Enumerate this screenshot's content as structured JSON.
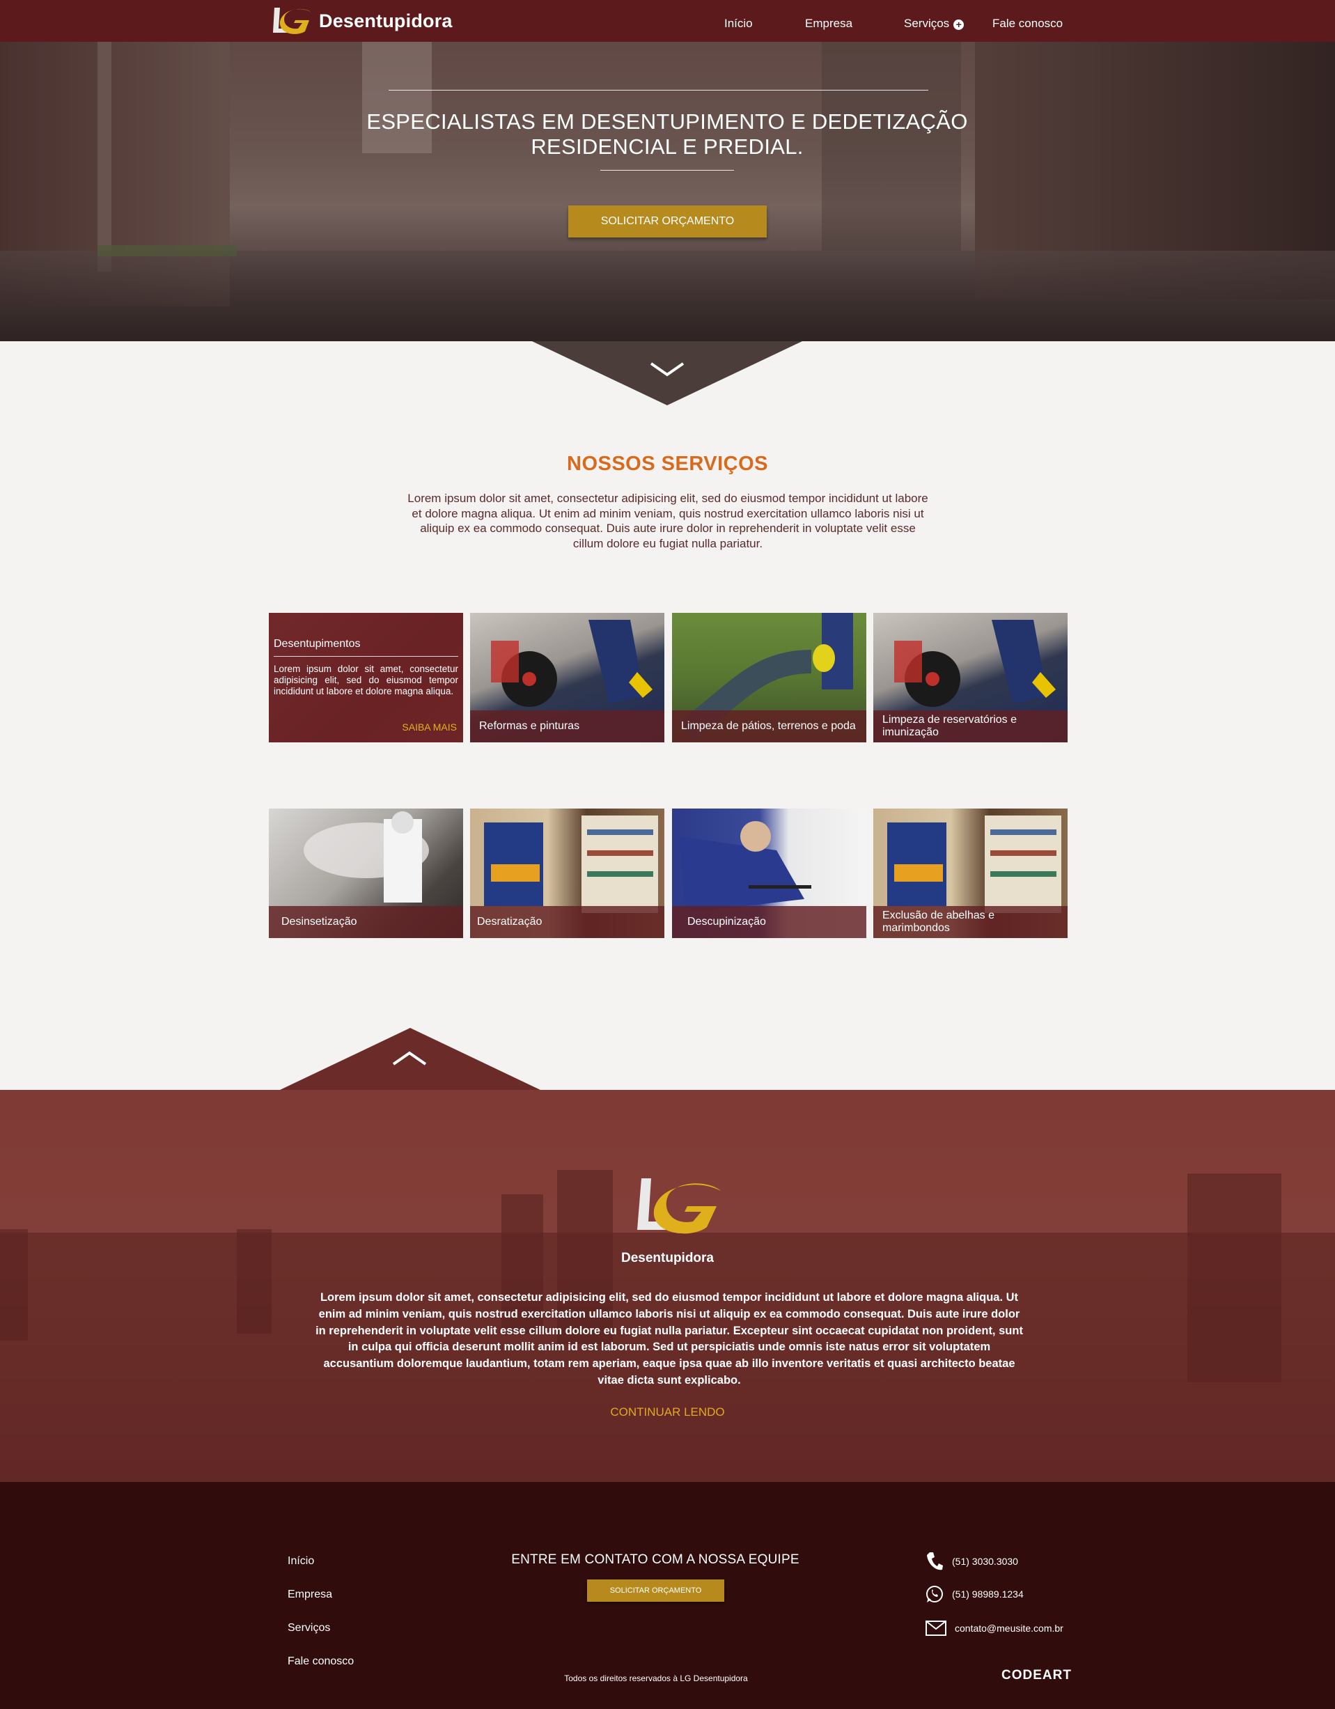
{
  "header": {
    "brand": "Desentupidora",
    "nav": [
      {
        "label": "Início"
      },
      {
        "label": "Empresa"
      },
      {
        "label": "Serviços"
      },
      {
        "label": "Fale conosco"
      }
    ]
  },
  "hero": {
    "title_line1": "ESPECIALISTAS EM DESENTUPIMENTO E DEDETIZAÇÃO",
    "title_line2": "RESIDENCIAL E PREDIAL.",
    "cta": "SOLICITAR ORÇAMENTO"
  },
  "services": {
    "title": "NOSSOS SERVIÇOS",
    "intro": "Lorem ipsum dolor sit amet, consectetur adipisicing elit, sed do eiusmod tempor incididunt ut labore et dolore magna aliqua. Ut enim ad minim veniam, quis nostrud exercitation ullamco laboris nisi ut aliquip ex ea commodo consequat. Duis aute irure dolor in reprehenderit in voluptate velit esse cillum dolore eu fugiat nulla pariatur.",
    "featured": {
      "title": "Desentupimentos",
      "text": "Lorem ipsum dolor sit amet, consectetur adipisicing elit, sed do eiusmod tempor incididunt ut labore et dolore magna aliqua.",
      "more": "SAIBA MAIS"
    },
    "items": [
      {
        "label": "Reformas e pinturas"
      },
      {
        "label": "Limpeza de pátios, terrenos e poda"
      },
      {
        "label": "Limpeza de reservatórios e imunização"
      },
      {
        "label": "Desinsetização"
      },
      {
        "label": "Desratização"
      },
      {
        "label": "Descupinização"
      },
      {
        "label": "Exclusão de abelhas e marimbondos"
      }
    ]
  },
  "about": {
    "brand": "Desentupidora",
    "text": "Lorem ipsum dolor sit amet, consectetur adipisicing elit, sed do eiusmod tempor incididunt ut labore et dolore magna aliqua. Ut enim ad minim veniam, quis nostrud exercitation ullamco laboris nisi ut aliquip ex ea commodo consequat. Duis aute irure dolor in reprehenderit in voluptate velit esse cillum dolore eu fugiat nulla pariatur. Excepteur sint occaecat cupidatat non proident, sunt in culpa qui officia deserunt mollit anim id est laborum. Sed ut perspiciatis unde omnis iste natus error sit voluptatem accusantium doloremque laudantium, totam rem aperiam, eaque ipsa quae ab illo inventore veritatis et quasi architecto beatae vitae dicta sunt explicabo.",
    "more": "CONTINUAR LENDO"
  },
  "footer": {
    "links": [
      {
        "label": "Início"
      },
      {
        "label": "Empresa"
      },
      {
        "label": "Serviços"
      },
      {
        "label": "Fale conosco"
      }
    ],
    "contact_title": "ENTRE EM CONTATO COM A NOSSA EQUIPE",
    "cta": "SOLICITAR ORÇAMENTO",
    "phone": "(51) 3030.3030",
    "whatsapp": "(51) 98989.1234",
    "email": "contato@meusite.com.br",
    "copyright": "Todos os direitos reservados à LG Desentupidora",
    "agency": "CODEART"
  },
  "colors": {
    "header": "#5d1a1c",
    "gold": "#b78a1e",
    "title_orange": "#d9691b",
    "footer": "#300c0c",
    "about": "#7a3632"
  }
}
